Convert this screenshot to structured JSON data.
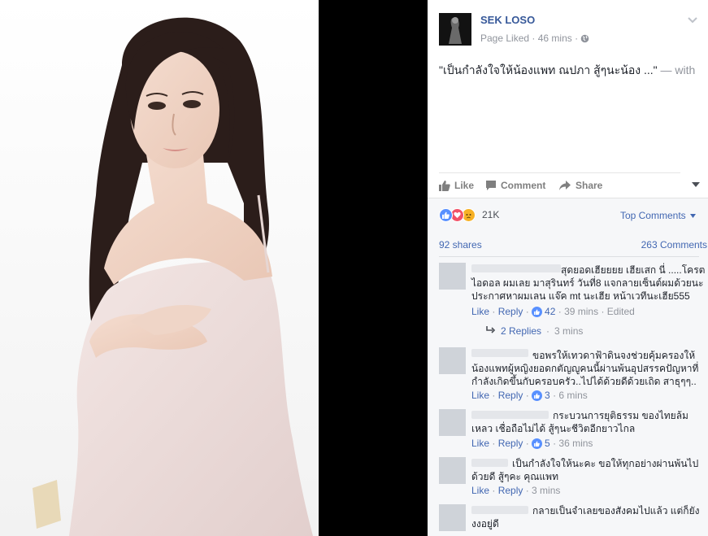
{
  "post": {
    "page_name": "SEK LOSO",
    "status": "Page Liked",
    "time": "46 mins",
    "caption": "\"เป็นกำลังใจให้น้องแพท ณปภา สู้ๆนะน้อง ...\"",
    "caption_with": "— with"
  },
  "actions": {
    "like": "Like",
    "comment": "Comment",
    "share": "Share"
  },
  "reactions": {
    "count": "21K",
    "top_comments": "Top Comments"
  },
  "stats": {
    "shares": "92 shares",
    "comments": "263 Comments"
  },
  "comments": [
    {
      "text": "สุดยอดเฮียยยย เฮียเสก นี่ .....โครตไอดอล ผมเลย มาสุรินทร์ วันที่8 แจกลายเซ็นต์ผมด้วยนะ ประกาศหาผมเลน แจ๊ค mt นะเฮีย หน้าเวทีนะเฮีย555",
      "like": "Like",
      "reply": "Reply",
      "likes": "42",
      "time": "39 mins",
      "edited": "Edited",
      "replies": "2 Replies",
      "replies_time": "3 mins"
    },
    {
      "text": "ขอพรให้เทวดาฟ้าดินจงช่วยคุ้มครองให้น้องแพทผู้หญิงยอดกตัญญูคนนี้ผ่านพ้นอุปสรรคปัญหาที่กำลังเกิดขึ้นกับครอบครัว..ไปได้ด้วยดีด้วยเถิด สาธุๆๆ..",
      "like": "Like",
      "reply": "Reply",
      "likes": "3",
      "time": "6 mins"
    },
    {
      "text": "กระบวนการยุติธรรม ของไทยล้มเหลว เชื่อถือไม่ได้ สู้ๆนะชีวิตอีกยาวไกล",
      "like": "Like",
      "reply": "Reply",
      "likes": "5",
      "time": "36 mins"
    },
    {
      "text": "เป็นกำลังใจให้นะคะ ขอให้ทุกอย่างผ่านพ้นไปด้วยดี สู้ๆคะ คุณแพท",
      "like": "Like",
      "reply": "Reply",
      "time": "3 mins"
    },
    {
      "text": "กลายเป็นจำเลยของสังคมไปแล้ว แต่ก็ยังงงอยู่ดี"
    }
  ],
  "colors": {
    "link_blue": "#4267b2",
    "name_blue": "#365899",
    "like_blue": "#5890ff",
    "love_red": "#f25268",
    "sad_yellow": "#f7b125"
  }
}
